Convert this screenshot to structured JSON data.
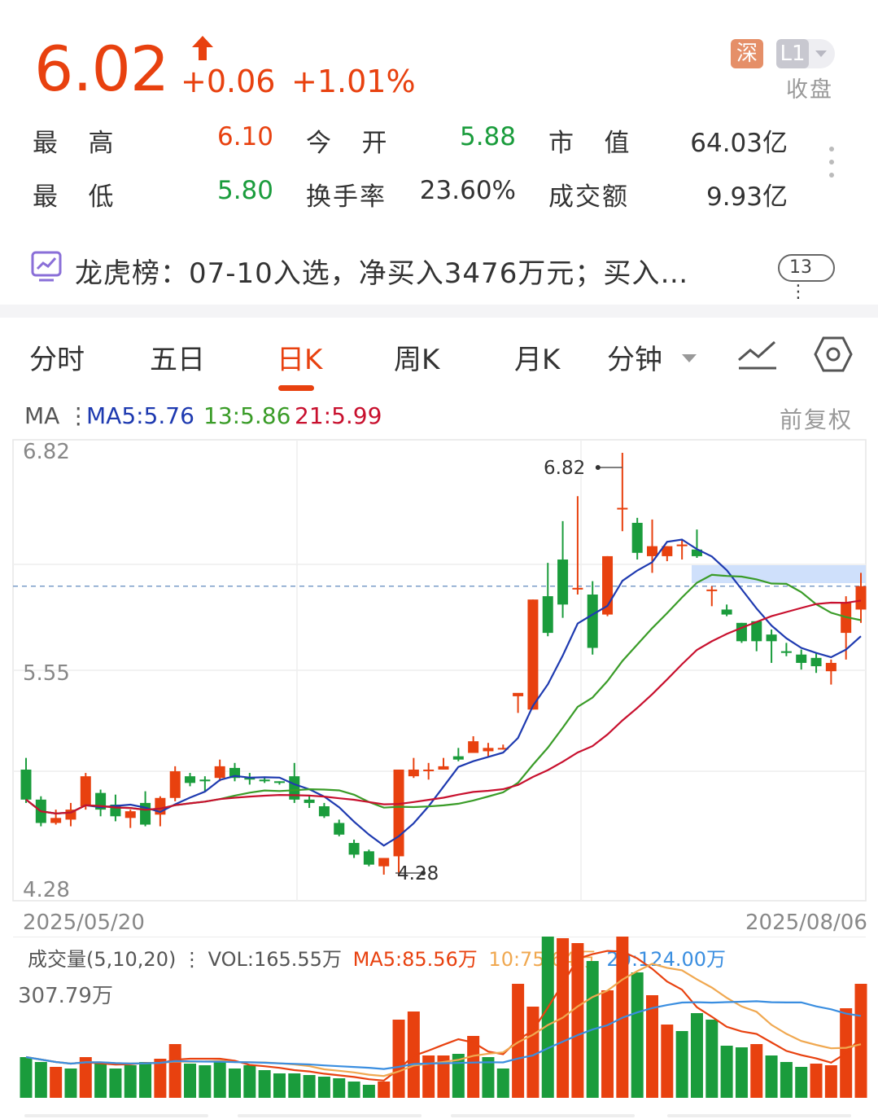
{
  "quote": {
    "price": "6.02",
    "change": "+0.06",
    "change_pct": "+1.01%",
    "exchange_badge": "深",
    "level_badge": "L1",
    "status": "收盘",
    "stats": [
      {
        "label": "最  高",
        "value": "6.10",
        "tone": "red"
      },
      {
        "label": "今  开",
        "value": "5.88",
        "tone": "green"
      },
      {
        "label": "市  值",
        "value": "64.03亿",
        "tone": "dark"
      },
      {
        "label": "最  低",
        "value": "5.80",
        "tone": "green"
      },
      {
        "label": "换手率",
        "value": "23.60%",
        "tone": "dark"
      },
      {
        "label": "成交额",
        "value": "9.93亿",
        "tone": "dark"
      }
    ]
  },
  "dragon_tiger": {
    "text": "龙虎榜：07-10入选，净买入3476万元；买入…",
    "count": "13"
  },
  "tabs": [
    "分时",
    "五日",
    "日K",
    "周K",
    "月K",
    "分钟"
  ],
  "active_tab": "日K",
  "ma_legend": {
    "prefix": "MA",
    "ma5": "MA5:5.76",
    "ma13": "13:5.86",
    "ma21": "21:5.99",
    "adjust": "前复权"
  },
  "colors": {
    "up": "#e8410f",
    "down": "#1a9c3c",
    "ma5": "#1e3ab0",
    "ma13": "#3a9c28",
    "ma21": "#c8102e",
    "vol_ma5": "#e8410f",
    "vol_ma10": "#f0a850",
    "vol_ma20": "#3a8ee0"
  },
  "kline_axis": {
    "y_high": "6.82",
    "y_mid": "5.55",
    "y_low": "4.28",
    "x_start": "2025/05/20",
    "x_end": "2025/08/06",
    "max_marker": "6.82",
    "min_marker": "4.28"
  },
  "volume": {
    "legend_prefix": "成交量(5,10,20)",
    "vol": "VOL:165.55万",
    "ma5": "MA5:85.56万",
    "ma10": "10:75.64万",
    "ma20": "20:124.00万",
    "max_label": "307.79万"
  },
  "chart_data": {
    "type": "candlestick",
    "ylim": [
      4.28,
      6.82
    ],
    "x_range": [
      "2025/05/20",
      "2025/08/06"
    ],
    "candles": [
      [
        4.92,
        4.74,
        4.99,
        4.72
      ],
      [
        4.74,
        4.6,
        4.76,
        4.58
      ],
      [
        4.6,
        4.63,
        4.68,
        4.59
      ],
      [
        4.62,
        4.68,
        4.72,
        4.58
      ],
      [
        4.7,
        4.88,
        4.9,
        4.68
      ],
      [
        4.78,
        4.68,
        4.8,
        4.64
      ],
      [
        4.71,
        4.64,
        4.77,
        4.61
      ],
      [
        4.63,
        4.67,
        4.68,
        4.57
      ],
      [
        4.72,
        4.59,
        4.79,
        4.58
      ],
      [
        4.65,
        4.75,
        4.76,
        4.58
      ],
      [
        4.75,
        4.91,
        4.94,
        4.73
      ],
      [
        4.88,
        4.84,
        4.9,
        4.82
      ],
      [
        4.86,
        4.85,
        4.88,
        4.79
      ],
      [
        4.87,
        4.94,
        4.98,
        4.85
      ],
      [
        4.93,
        4.87,
        4.96,
        4.85
      ],
      [
        4.87,
        4.86,
        4.9,
        4.83
      ],
      [
        4.86,
        4.85,
        4.87,
        4.84
      ],
      [
        4.85,
        4.84,
        4.85,
        4.83
      ],
      [
        4.88,
        4.74,
        4.96,
        4.72
      ],
      [
        4.74,
        4.72,
        4.76,
        4.69
      ],
      [
        4.7,
        4.64,
        4.72,
        4.63
      ],
      [
        4.6,
        4.53,
        4.62,
        4.52
      ],
      [
        4.48,
        4.41,
        4.5,
        4.39
      ],
      [
        4.43,
        4.35,
        4.44,
        4.34
      ],
      [
        4.34,
        4.39,
        4.39,
        4.29
      ],
      [
        4.4,
        4.92,
        4.92,
        4.28
      ],
      [
        4.88,
        4.92,
        4.99,
        4.87
      ],
      [
        4.92,
        4.92,
        4.96,
        4.86
      ],
      [
        4.92,
        4.94,
        4.99,
        4.92
      ],
      [
        5.0,
        4.98,
        5.05,
        4.97
      ],
      [
        5.02,
        5.09,
        5.12,
        5.02
      ],
      [
        5.03,
        5.05,
        5.08,
        5.0
      ],
      [
        5.05,
        5.05,
        5.07,
        5.04
      ],
      [
        5.36,
        5.38,
        5.37,
        5.26
      ],
      [
        5.28,
        5.94,
        5.94,
        5.28
      ],
      [
        5.96,
        5.74,
        6.16,
        5.72
      ],
      [
        6.18,
        5.91,
        6.41,
        5.83
      ],
      [
        6.0,
        6.01,
        6.56,
        5.97
      ],
      [
        5.97,
        5.65,
        6.05,
        5.61
      ],
      [
        5.85,
        6.2,
        6.2,
        5.84
      ],
      [
        6.48,
        6.49,
        6.82,
        6.35
      ],
      [
        6.4,
        6.22,
        6.43,
        6.18
      ],
      [
        6.2,
        6.26,
        6.42,
        6.1
      ],
      [
        6.2,
        6.26,
        6.26,
        6.17
      ],
      [
        6.26,
        6.27,
        6.3,
        6.18
      ],
      [
        6.24,
        6.2,
        6.36,
        6.19
      ],
      [
        6.0,
        6.0,
        6.02,
        5.9
      ],
      [
        5.88,
        5.85,
        5.91,
        5.84
      ],
      [
        5.8,
        5.69,
        5.8,
        5.68
      ],
      [
        5.81,
        5.69,
        5.81,
        5.63
      ],
      [
        5.73,
        5.69,
        5.76,
        5.56
      ],
      [
        5.63,
        5.62,
        5.68,
        5.6
      ],
      [
        5.61,
        5.56,
        5.64,
        5.52
      ],
      [
        5.59,
        5.54,
        5.62,
        5.5
      ],
      [
        5.51,
        5.56,
        5.58,
        5.43
      ],
      [
        5.74,
        5.92,
        5.96,
        5.58
      ],
      [
        5.88,
        6.02,
        6.1,
        5.8
      ]
    ],
    "volume_bars": [
      [
        50,
        "d"
      ],
      [
        44,
        "d"
      ],
      [
        38,
        "u"
      ],
      [
        36,
        "d"
      ],
      [
        50,
        "u"
      ],
      [
        44,
        "d"
      ],
      [
        36,
        "d"
      ],
      [
        40,
        "d"
      ],
      [
        44,
        "d"
      ],
      [
        48,
        "u"
      ],
      [
        66,
        "u"
      ],
      [
        42,
        "d"
      ],
      [
        40,
        "d"
      ],
      [
        44,
        "d"
      ],
      [
        36,
        "d"
      ],
      [
        40,
        "d"
      ],
      [
        34,
        "d"
      ],
      [
        30,
        "d"
      ],
      [
        30,
        "d"
      ],
      [
        28,
        "d"
      ],
      [
        26,
        "d"
      ],
      [
        24,
        "d"
      ],
      [
        20,
        "d"
      ],
      [
        16,
        "d"
      ],
      [
        20,
        "u"
      ],
      [
        96,
        "u"
      ],
      [
        106,
        "u"
      ],
      [
        52,
        "u"
      ],
      [
        52,
        "u"
      ],
      [
        54,
        "d"
      ],
      [
        76,
        "u"
      ],
      [
        50,
        "d"
      ],
      [
        36,
        "d"
      ],
      [
        140,
        "u"
      ],
      [
        112,
        "u"
      ],
      [
        216,
        "d"
      ],
      [
        196,
        "u"
      ],
      [
        190,
        "u"
      ],
      [
        168,
        "d"
      ],
      [
        132,
        "u"
      ],
      [
        212,
        "u"
      ],
      [
        154,
        "d"
      ],
      [
        126,
        "u"
      ],
      [
        90,
        "u"
      ],
      [
        82,
        "d"
      ],
      [
        104,
        "d"
      ],
      [
        96,
        "d"
      ],
      [
        64,
        "d"
      ],
      [
        62,
        "d"
      ],
      [
        66,
        "u"
      ],
      [
        52,
        "d"
      ],
      [
        44,
        "d"
      ],
      [
        38,
        "d"
      ],
      [
        42,
        "u"
      ],
      [
        40,
        "u"
      ],
      [
        110,
        "u"
      ],
      [
        140,
        "u"
      ]
    ]
  }
}
